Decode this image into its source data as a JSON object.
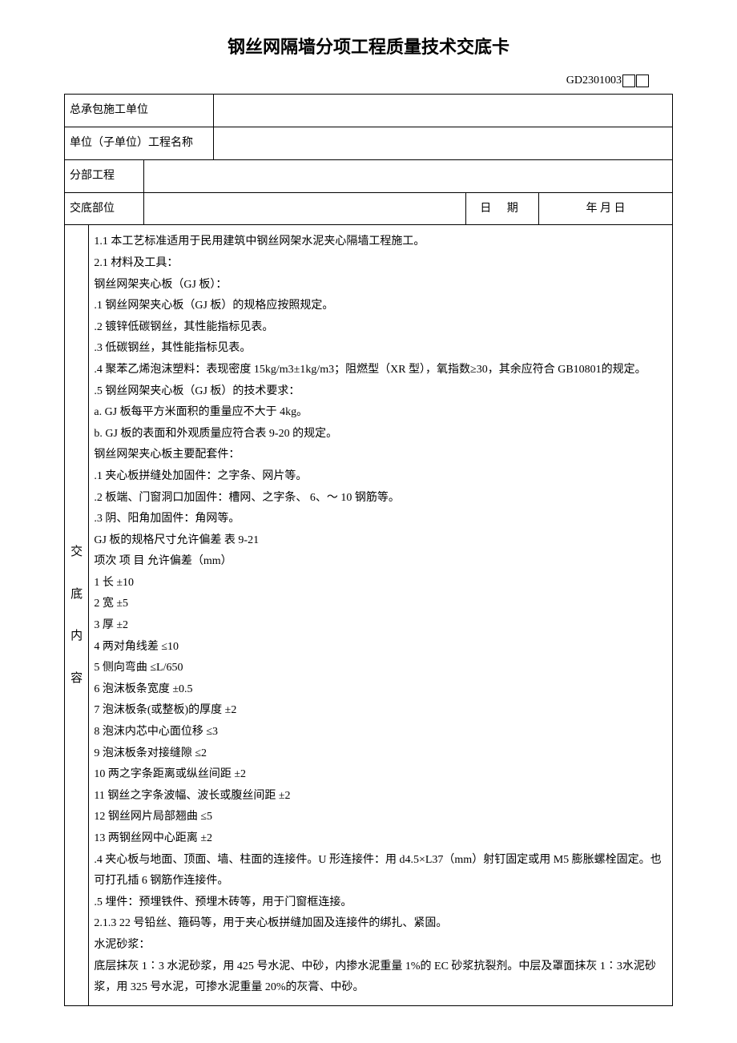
{
  "title": "钢丝网隔墙分项工程质量技术交底卡",
  "docnum": "GD2301003",
  "rows": {
    "contractor_label": "总承包施工单位",
    "contractor_value": "",
    "unit_label": "单位（子单位）工程名称",
    "unit_value": "",
    "subproject_label": "分部工程",
    "subproject_value": "",
    "position_label": "交底部位",
    "position_value": "",
    "date_label": "日 期",
    "date_value": "年  月    日"
  },
  "side_label_chars": [
    "交",
    "底",
    "内",
    "容"
  ],
  "content_lines": [
    "1.1 本工艺标准适用于民用建筑中钢丝网架水泥夹心隔墙工程施工。",
    "2.1 材料及工具：",
    " 钢丝网架夹心板（GJ 板）：",
    ".1 钢丝网架夹心板（GJ 板）的规格应按照规定。",
    ".2 镀锌低碳钢丝，其性能指标见表。",
    ".3 低碳钢丝，其性能指标见表。",
    ".4 聚苯乙烯泡沫塑料：表现密度 15kg/m3±1kg/m3；阻燃型（XR 型），氧指数≥30，其余应符合 GB10801的规定。",
    ".5 钢丝网架夹心板（GJ 板）的技术要求：",
    "a. GJ 板每平方米面积的重量应不大于 4kg。",
    "b. GJ 板的表面和外观质量应符合表 9-20 的规定。",
    " 钢丝网架夹心板主要配套件：",
    ".1 夹心板拼缝处加固件：之字条、网片等。",
    ".2 板端、门窗洞口加固件：槽网、之字条、 6、～ 10 钢筋等。",
    ".3 阴、阳角加固件：角网等。",
    "GJ 板的规格尺寸允许偏差 表 9-21",
    "项次 项 目 允许偏差（mm）",
    "1 长 ±10",
    "2 宽 ±5",
    "3 厚 ±2",
    "4 两对角线差 ≤10",
    "5 侧向弯曲 ≤L/650",
    "6 泡沫板条宽度 ±0.5",
    "7 泡沫板条(或整板)的厚度 ±2",
    "8 泡沫内芯中心面位移 ≤3",
    "9 泡沫板条对接缝隙 ≤2",
    "10 两之字条距离或纵丝间距 ±2",
    "11 钢丝之字条波幅、波长或腹丝间距 ±2",
    "12 钢丝网片局部翘曲 ≤5",
    "13 两钢丝网中心距离 ±2",
    ".4 夹心板与地面、顶面、墙、柱面的连接件。U 形连接件：用 d4.5×L37（mm）射钉固定或用 M5 膨胀螺栓固定。也可打孔插 6 钢筋作连接件。",
    ".5 埋件：预埋铁件、预埋木砖等，用于门窗框连接。",
    "2.1.3 22 号铅丝、箍码等，用于夹心板拼缝加固及连接件的绑扎、紧固。",
    " 水泥砂浆：",
    "底层抹灰 1∶3 水泥砂浆，用 425 号水泥、中砂，内掺水泥重量 1%的 EC 砂浆抗裂剂。中层及罩面抹灰 1∶3水泥砂浆，用 325 号水泥，可掺水泥重量 20%的灰膏、中砂。"
  ]
}
